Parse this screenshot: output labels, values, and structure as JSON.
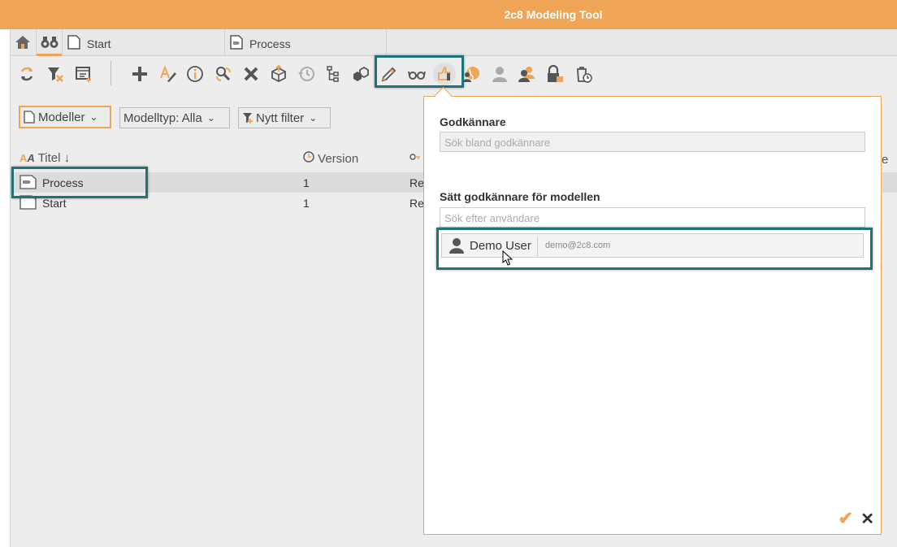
{
  "app": {
    "title": "2c8 Modeling Tool"
  },
  "tabs": [
    {
      "label": "Start"
    },
    {
      "label": "Process"
    }
  ],
  "toolbar": {
    "icons": [
      "refresh-icon",
      "clear-filter-icon",
      "add-column-icon",
      "plus-icon",
      "rename-icon",
      "info-icon",
      "replace-icon",
      "delete-icon",
      "export-box-icon",
      "history-icon",
      "tree-icon",
      "boxes-icon",
      "pencil-icon",
      "glasses-icon",
      "thumbs-up-icon",
      "globe-user-icon",
      "user-icon",
      "users-icon",
      "lock-user-icon",
      "trash-clock-icon"
    ]
  },
  "filters": {
    "models": "Modeller",
    "model_type": "Modelltyp: Alla",
    "new_filter": "Nytt filter"
  },
  "table": {
    "columns": {
      "title": "Titel ↓",
      "version": "Version",
      "partial": "Re",
      "cut_right": "e"
    },
    "rows": [
      {
        "title": "Process",
        "version": "1",
        "col3": "Re"
      },
      {
        "title": "Start",
        "version": "1",
        "col3": "Re"
      }
    ]
  },
  "panel": {
    "approvers_label": "Godkännare",
    "approvers_placeholder": "Sök bland godkännare",
    "set_label": "Sätt godkännare för modellen",
    "user_search_placeholder": "Sök efter användare",
    "user": {
      "name": "Demo User",
      "email": "demo@2c8.com"
    },
    "confirm_icon": "✔",
    "cancel_icon": "✕"
  },
  "colors": {
    "accent": "#f0a455",
    "highlight": "#1d7478"
  }
}
